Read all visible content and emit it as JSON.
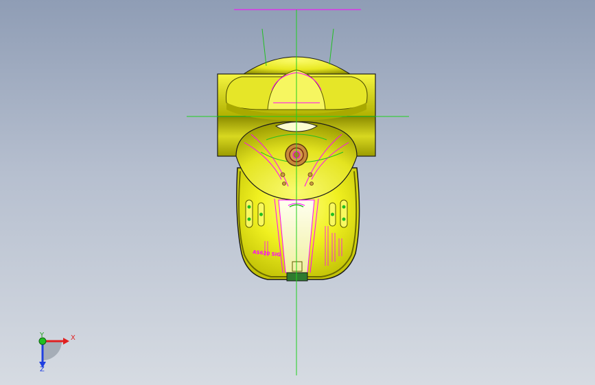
{
  "viewport": {
    "background_top": "#8f9db5",
    "background_bottom": "#d6dbe2"
  },
  "model": {
    "engraved_text": "AS620 SIG",
    "body_color": "#ecec1a",
    "shadow_color": "#7a7a05",
    "feature_line_color": "#ff00ff",
    "edge_line_color": "#1a1a1a",
    "centerline_color": "#20d020"
  },
  "triad": {
    "x_label": "X",
    "y_label": "Y",
    "z_label": "Z",
    "x_color": "#e02020",
    "y_color": "#20c020",
    "z_color": "#2040e0"
  }
}
